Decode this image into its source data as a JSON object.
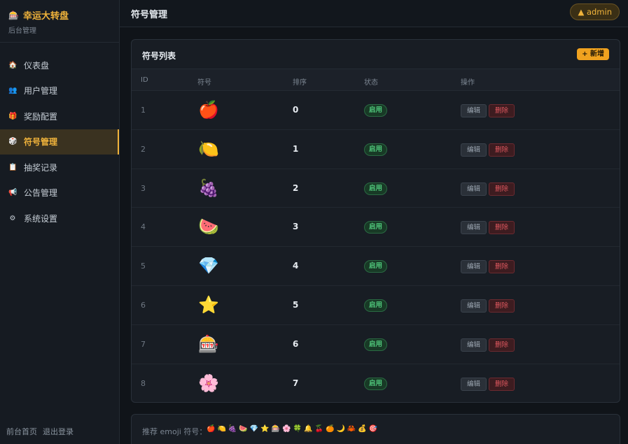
{
  "brand": {
    "icon": "🎰",
    "title": "幸运大转盘",
    "subtitle": "后台管理"
  },
  "nav": [
    {
      "icon": "🏠",
      "label": "仪表盘",
      "name": "dashboard"
    },
    {
      "icon": "👥",
      "label": "用户管理",
      "name": "users"
    },
    {
      "icon": "🎁",
      "label": "奖励配置",
      "name": "rewards"
    },
    {
      "icon": "🎲",
      "label": "符号管理",
      "name": "symbols",
      "active": true
    },
    {
      "icon": "📋",
      "label": "抽奖记录",
      "name": "records"
    },
    {
      "icon": "📢",
      "label": "公告管理",
      "name": "announcements"
    },
    {
      "icon": "⚙",
      "label": "系统设置",
      "name": "settings"
    }
  ],
  "footer": {
    "home": "前台首页",
    "logout": "退出登录"
  },
  "topbar": {
    "title": "符号管理",
    "user": "▲ admin"
  },
  "card": {
    "title": "符号列表",
    "add_label": "+ 新增",
    "columns": {
      "id": "ID",
      "symbol": "符号",
      "order": "排序",
      "status": "状态",
      "actions": "操作"
    }
  },
  "rows": [
    {
      "id": "1",
      "symbol": "🍎",
      "order": "0",
      "status": "启用"
    },
    {
      "id": "2",
      "symbol": "🍋",
      "order": "1",
      "status": "启用"
    },
    {
      "id": "3",
      "symbol": "🍇",
      "order": "2",
      "status": "启用"
    },
    {
      "id": "4",
      "symbol": "🍉",
      "order": "3",
      "status": "启用"
    },
    {
      "id": "5",
      "symbol": "💎",
      "order": "4",
      "status": "启用"
    },
    {
      "id": "6",
      "symbol": "⭐",
      "order": "5",
      "status": "启用"
    },
    {
      "id": "7",
      "symbol": "🎰",
      "order": "6",
      "status": "启用"
    },
    {
      "id": "8",
      "symbol": "🌸",
      "order": "7",
      "status": "启用"
    }
  ],
  "row_actions": {
    "edit": "编辑",
    "delete": "删除"
  },
  "recommend": {
    "label": "推荐 emoji 符号：",
    "emojis": [
      "🍎",
      "🍋",
      "🍇",
      "🍉",
      "💎",
      "⭐",
      "🎰",
      "🌸",
      "🍀",
      "🔔",
      "🍒",
      "🍊",
      "🌙",
      "🦀",
      "💰",
      "🎯"
    ]
  },
  "colors": {
    "accent": "#f0b33b",
    "success": "#4fc57a",
    "danger": "#e0585f"
  }
}
